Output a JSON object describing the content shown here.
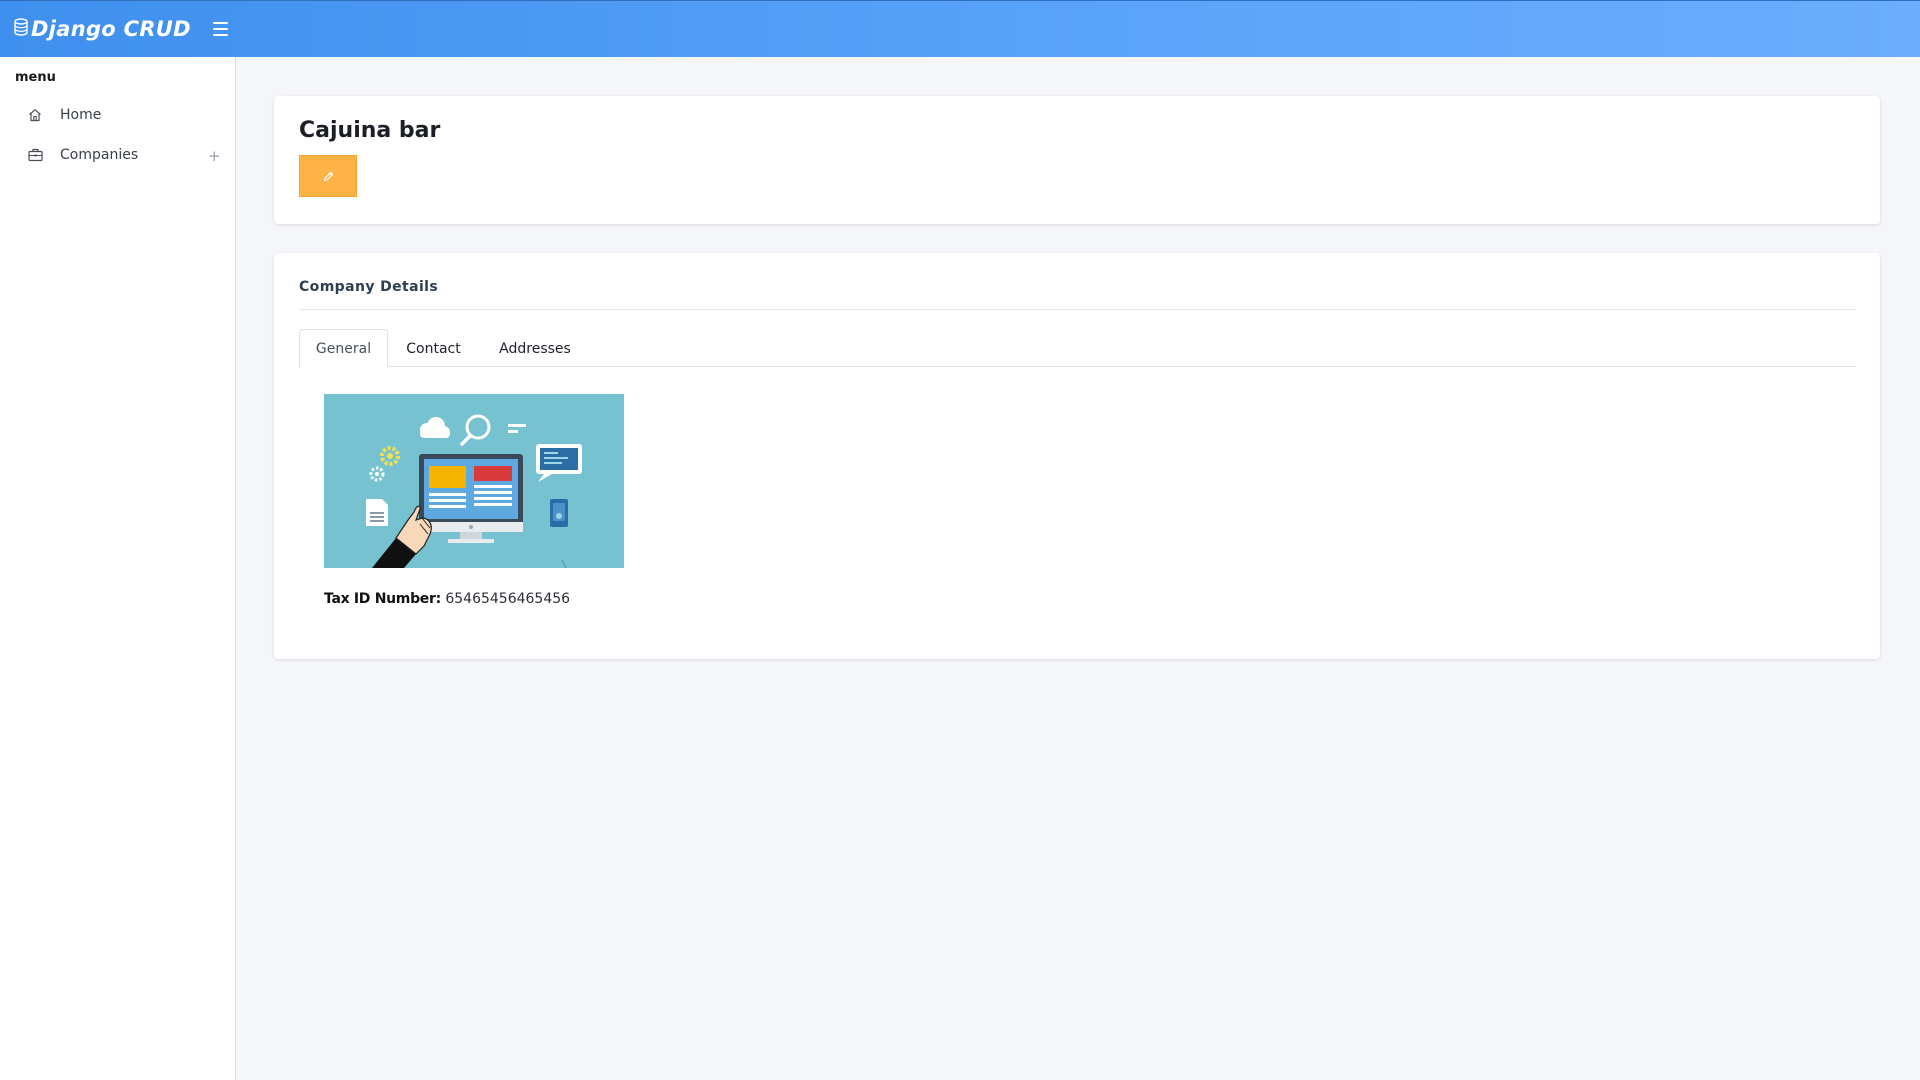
{
  "app": {
    "brand_title": "Django CRUD",
    "brand_icon": "database-icon",
    "menu_toggle_icon": "hamburger-icon"
  },
  "sidebar": {
    "heading": "menu",
    "items": [
      {
        "label": "Home",
        "icon": "home-icon"
      },
      {
        "label": "Companies",
        "icon": "briefcase-icon",
        "expand_icon": "plus-icon",
        "expand_glyph": "+"
      }
    ]
  },
  "header_card": {
    "title": "Cajuina bar",
    "edit_button_icon": "pencil-icon"
  },
  "details_card": {
    "section_title": "Company Details",
    "tabs": [
      {
        "label": "General",
        "active": true
      },
      {
        "label": "Contact",
        "active": false
      },
      {
        "label": "Addresses",
        "active": false
      }
    ],
    "general": {
      "image": "company-illustration",
      "tax_id_label": "Tax ID Number:",
      "tax_id_value": "65465456465456"
    }
  },
  "colors": {
    "topbar_start": "#3f8fee",
    "topbar_end": "#6aaefc",
    "edit_button": "#ffb347",
    "background": "#f5f6f9",
    "image_bg": "#76c2d0"
  }
}
